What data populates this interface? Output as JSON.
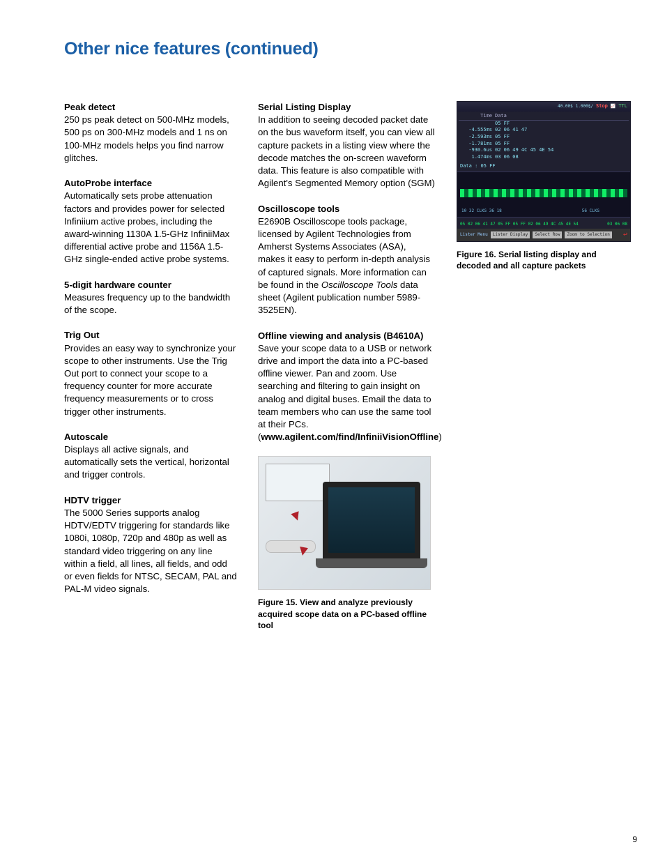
{
  "pageTitle": "Other nice features (continued)",
  "col1": {
    "s1": {
      "hdr": "Peak detect",
      "body": "250 ps peak detect on 500-MHz models, 500 ps on 300-MHz models and 1 ns on 100-MHz models helps you find narrow glitches."
    },
    "s2": {
      "hdr": "AutoProbe interface",
      "body": "Automatically sets probe attenuation factors and provides power for selected Infiniium active probes, including the award-winning 1130A 1.5-GHz InfiniiMax differential active probe and 1156A 1.5-GHz single-ended active probe systems."
    },
    "s3": {
      "hdr": "5-digit hardware counter",
      "body": "Measures frequency up to the bandwidth of the scope."
    },
    "s4": {
      "hdr": "Trig Out",
      "body": "Provides an easy way to synchronize your scope to other instruments. Use the Trig Out port to connect your scope to a frequency counter for more accurate frequency measurements or to cross trigger other instruments."
    },
    "s5": {
      "hdr": "Autoscale",
      "body": "Displays all active signals, and automatically sets the vertical, horizontal and trigger controls."
    },
    "s6": {
      "hdr": "HDTV trigger",
      "body": "The 5000 Series supports analog HDTV/EDTV triggering for standards like 1080i, 1080p, 720p and 480p as well as standard video triggering on any line within a field, all lines, all fields, and odd or even fields for NTSC, SECAM, PAL and PAL-M video signals."
    }
  },
  "col2": {
    "s1": {
      "hdr": "Serial Listing Display",
      "body": "In addition to seeing decoded packet date on the bus waveform itself, you can view all capture packets in a listing view where the decode matches the on-screen waveform data. This feature is also compatible with Agilent's Segmented Memory option (SGM)"
    },
    "s2": {
      "hdr": "Oscilloscope tools",
      "body_a": "E2690B Oscilloscope tools package, licensed by Agilent Technologies from Amherst Systems Associates (ASA), makes it easy to perform in-depth analysis of captured signals. More information can be found in the ",
      "body_b_italic": "Oscilloscope Tools",
      "body_c": " data sheet (Agilent publication number 5989-3525EN)."
    },
    "s3": {
      "hdr": "Offline viewing and analysis (B4610A)",
      "body_a": "Save your scope data to a USB or network drive and import the data into a PC-based offline viewer. Pan and zoom. Use searching and filtering to gain insight on analog and digital buses. Email the data to team members who can use the same tool at their PCs. (",
      "body_b_bold": "www.agilent.com/find/InfiniiVisionOffline",
      "body_c": ")"
    },
    "fig15_caption": "Figure 15. View and analyze previously acquired scope data on a PC-based offline tool"
  },
  "col3": {
    "fig16_caption": "Figure 16. Serial listing display and decoded and all capture packets",
    "scope": {
      "top_scale": "40.00$",
      "top_time": "1.000§/",
      "top_stop": "Stop",
      "top_ttl": "TTL",
      "tbl_head_time": "Time",
      "tbl_head_data": "Data",
      "rows": [
        {
          "t": "",
          "d": "05 FF"
        },
        {
          "t": "-4.555ms",
          "d": "02 06 41 47"
        },
        {
          "t": "-2.593ms",
          "d": "05 FF"
        },
        {
          "t": "-1.781ms",
          "d": "05 FF"
        },
        {
          "t": "-930.6us",
          "d": "02 06 49 4C 45 4E 54"
        },
        {
          "t": "1.474ms",
          "d": "03 06 08"
        }
      ],
      "data_label": "Data : 05  FF",
      "hex_left": "05  02  06  41  47  05 FF  05 FF  02  06  49  4C  45  4E  54",
      "hex_right": "03  06  08",
      "clk_a": "10        32 CLKS      36      18",
      "clk_b": "56 CLKS",
      "menu_title": "Lister Menu",
      "menu_btn1": "Lister Display",
      "menu_btn2": "Select Row",
      "menu_btn3": "Zoom to Selection"
    }
  },
  "pageNumber": "9"
}
